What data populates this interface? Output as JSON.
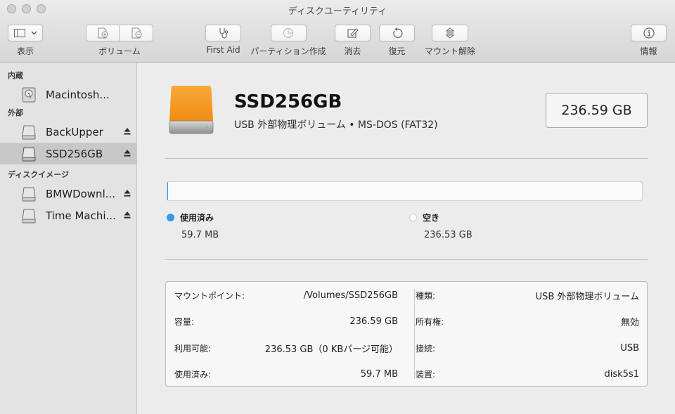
{
  "window": {
    "title": "ディスクユーティリティ"
  },
  "toolbar": {
    "view_label": "表示",
    "volume_label": "ボリューム",
    "firstaid_label": "First Aid",
    "partition_label": "パーティション作成",
    "erase_label": "消去",
    "restore_label": "復元",
    "unmount_label": "マウント解除",
    "info_label": "情報"
  },
  "sidebar": {
    "sections": [
      {
        "title": "内蔵",
        "items": [
          {
            "label": "Macintosh..."
          }
        ]
      },
      {
        "title": "外部",
        "items": [
          {
            "label": "BackUpper"
          },
          {
            "label": "SSD256GB"
          }
        ]
      },
      {
        "title": "ディスクイメージ",
        "items": [
          {
            "label": "BMWDownl..."
          },
          {
            "label": "Time Machi..."
          }
        ]
      }
    ],
    "selected": "SSD256GB"
  },
  "volume": {
    "name": "SSD256GB",
    "subtitle": "USB 外部物理ボリューム • MS-DOS (FAT32)",
    "size": "236.59 GB",
    "used_title": "使用済み",
    "used_value": "59.7 MB",
    "free_title": "空き",
    "free_value": "236.53 GB",
    "used_fraction": 0.0003
  },
  "colors": {
    "used": "#2f9bea",
    "free": "#ffffff",
    "drive": "#f39a1c"
  },
  "details": {
    "left": [
      {
        "key": "マウントポイント:",
        "value": "/Volumes/SSD256GB"
      },
      {
        "key": "容量:",
        "value": "236.59 GB"
      },
      {
        "key": "利用可能:",
        "value": "236.53 GB（0 KBパージ可能）"
      },
      {
        "key": "使用済み:",
        "value": "59.7 MB"
      }
    ],
    "right": [
      {
        "key": "種類:",
        "value": "USB 外部物理ボリューム"
      },
      {
        "key": "所有権:",
        "value": "無効"
      },
      {
        "key": "接続:",
        "value": "USB"
      },
      {
        "key": "装置:",
        "value": "disk5s1"
      }
    ]
  }
}
